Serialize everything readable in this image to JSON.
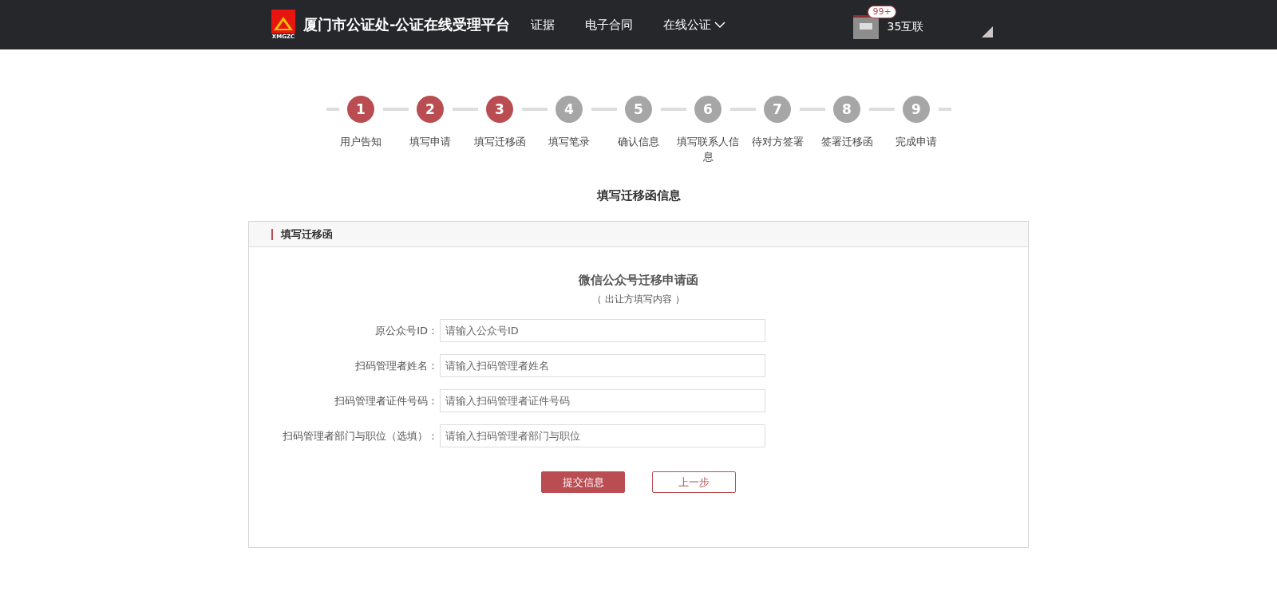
{
  "header": {
    "logo_text": "XMGZC",
    "title": "厦门市公证处-公证在线受理平台",
    "nav": [
      {
        "label": "证据",
        "dropdown": false
      },
      {
        "label": "电子合同",
        "dropdown": false
      },
      {
        "label": "在线公证",
        "dropdown": true
      }
    ],
    "user": {
      "badge": "99+",
      "name": "35互联"
    }
  },
  "steps": [
    {
      "number": "1",
      "label": "用户告知",
      "done": true
    },
    {
      "number": "2",
      "label": "填写申请",
      "done": true
    },
    {
      "number": "3",
      "label": "填写迁移函",
      "done": true
    },
    {
      "number": "4",
      "label": "填写笔录",
      "done": false
    },
    {
      "number": "5",
      "label": "确认信息",
      "done": false
    },
    {
      "number": "6",
      "label": "填写联系人信息",
      "done": false
    },
    {
      "number": "7",
      "label": "待对方签署",
      "done": false
    },
    {
      "number": "8",
      "label": "签署迁移函",
      "done": false
    },
    {
      "number": "9",
      "label": "完成申请",
      "done": false
    }
  ],
  "page_title": "填写迁移函信息",
  "panel": {
    "title": "填写迁移函",
    "form_title": "微信公众号迁移申请函",
    "form_subtitle": "（ 出让方填写内容 ）",
    "fields": [
      {
        "label": "原公众号ID：",
        "placeholder": "请输入公众号ID"
      },
      {
        "label": "扫码管理者姓名：",
        "placeholder": "请输入扫码管理者姓名"
      },
      {
        "label": "扫码管理者证件号码：",
        "placeholder": "请输入扫码管理者证件号码"
      },
      {
        "label": "扫码管理者部门与职位（选填）：",
        "placeholder": "请输入扫码管理者部门与职位"
      }
    ],
    "buttons": [
      {
        "label": "提交信息",
        "kind": "primary"
      },
      {
        "label": "上一步",
        "kind": "secondary"
      }
    ]
  }
}
